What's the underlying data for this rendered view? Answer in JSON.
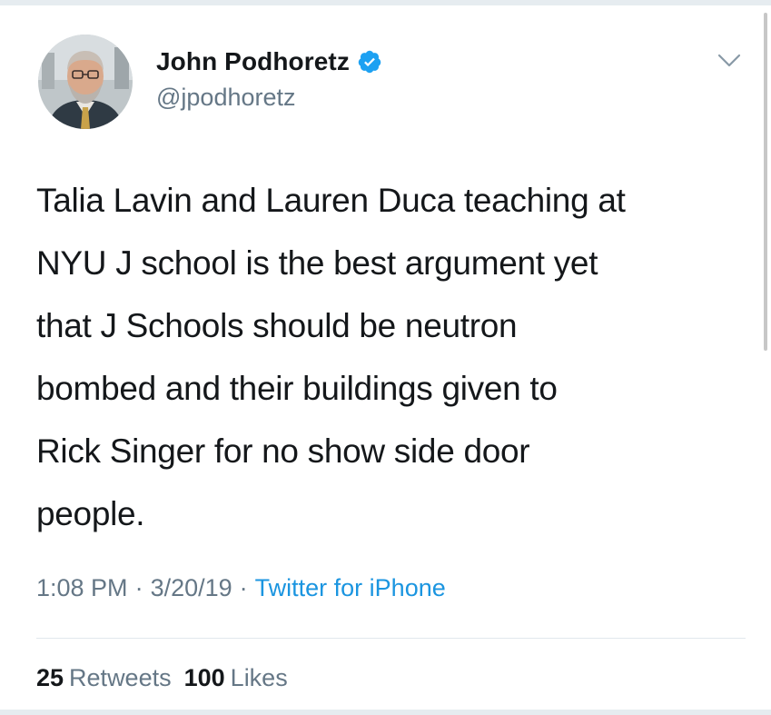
{
  "author": {
    "display_name": "John Podhoretz",
    "handle": "@jpodhoretz",
    "verified": true,
    "avatar_icon": "user-avatar-photo"
  },
  "tweet": {
    "text": "Talia Lavin and Lauren Duca teaching at\nNYU J school is the best argument yet\nthat J Schools should be neutron\nbombed and their buildings given to\nRick Singer for no show side door\npeople."
  },
  "meta": {
    "time": "1:08 PM",
    "separator": "·",
    "date": "3/20/19",
    "source": "Twitter for iPhone"
  },
  "stats": {
    "retweets_count": "25",
    "retweets_label": "Retweets",
    "likes_count": "100",
    "likes_label": "Likes"
  },
  "colors": {
    "link": "#1b95e0",
    "verified": "#1da1f2",
    "secondary_text": "#657786",
    "primary_text": "#14171a"
  },
  "icons": {
    "verified": "verified-badge-icon",
    "more": "chevron-down-icon"
  }
}
